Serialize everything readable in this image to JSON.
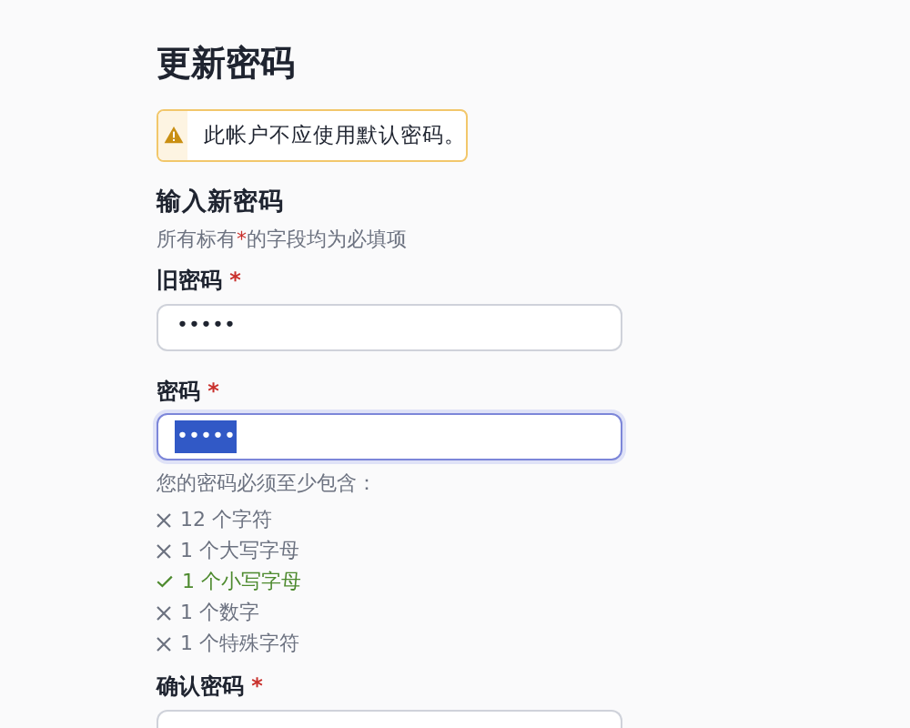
{
  "title": "更新密码",
  "alert": {
    "text": "此帐户不应使用默认密码。"
  },
  "section_title": "输入新密码",
  "required_note": {
    "before": "所有标有",
    "mark": "*",
    "after": "的字段均为必填项"
  },
  "fields": [
    {
      "label": "旧密码",
      "required": true,
      "value": "•••••",
      "focused": false,
      "text_selected": false
    },
    {
      "label": "密码",
      "required": true,
      "value": "•••••",
      "focused": true,
      "text_selected": true
    }
  ],
  "requirements": {
    "intro": "您的密码必须至少包含：",
    "items": [
      {
        "text": "12 个字符",
        "met": false
      },
      {
        "text": "1 个大写字母",
        "met": false
      },
      {
        "text": "1 个小写字母",
        "met": true
      },
      {
        "text": "1 个数字",
        "met": false
      },
      {
        "text": "1 个特殊字符",
        "met": false
      }
    ]
  },
  "confirm_field": {
    "label": "确认密码",
    "required": true
  }
}
